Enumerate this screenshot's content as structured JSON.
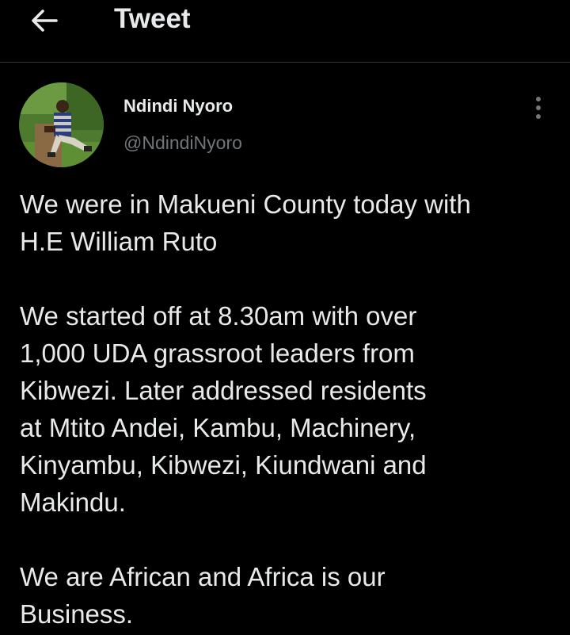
{
  "header": {
    "title": "Tweet",
    "back_icon": "arrow-left-icon"
  },
  "author": {
    "name": "Ndindi Nyoro",
    "handle": "@NdindiNyoro",
    "avatar_icon": "avatar-photo"
  },
  "more_icon": "more-vertical-icon",
  "tweet": {
    "paragraphs": [
      "We were in Makueni County today with\nH.E William Ruto",
      "We started off at 8.30am with over\n1,000 UDA grassroot leaders from\nKibwezi. Later addressed residents\nat Mtito Andei, Kambu, Machinery,\nKinyambu, Kibwezi, Kiundwani and\nMakindu.",
      "We are African and Africa is our\nBusiness."
    ]
  },
  "colors": {
    "background": "#000000",
    "text": "#e7e9ea",
    "secondary_text": "#71767b",
    "divider": "#2f3336"
  }
}
